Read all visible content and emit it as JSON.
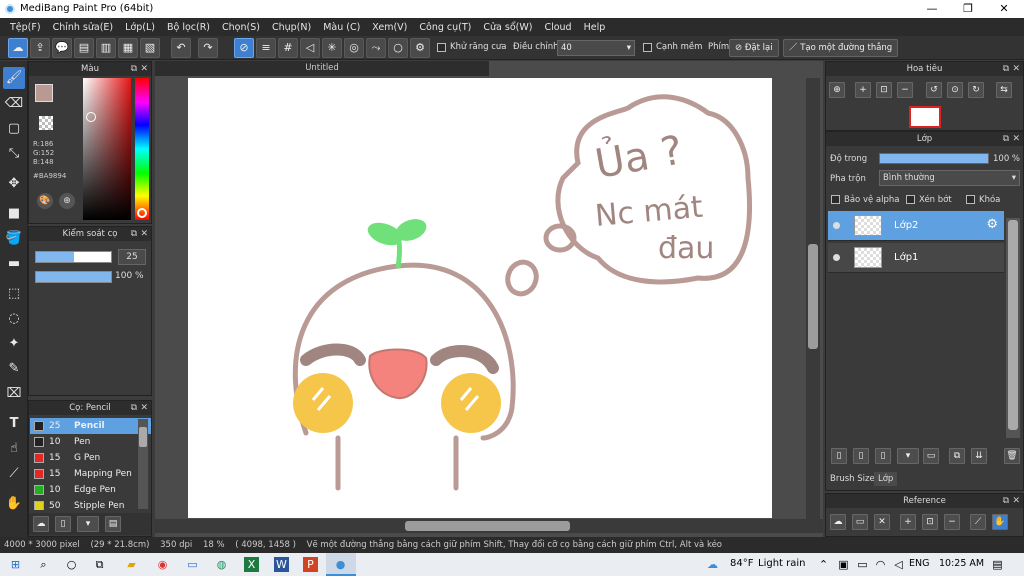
{
  "window": {
    "title": "MediBang Paint Pro (64bit)",
    "min": "—",
    "max": "❐",
    "close": "✕"
  },
  "menu": [
    "Tệp(F)",
    "Chỉnh sửa(E)",
    "Lớp(L)",
    "Bộ lọc(R)",
    "Chọn(S)",
    "Chụp(N)",
    "Màu (C)",
    "Xem(V)",
    "Công cụ(T)",
    "Cửa sổ(W)",
    "Cloud",
    "Help"
  ],
  "toolbar": {
    "antialias_label": "Khử răng cưa",
    "adjust_label": "Điều chỉnh",
    "adjust_value": "40",
    "soft_edge_label": "Cạnh mềm",
    "key_label": "Phím",
    "reset_label": "Đặt lại",
    "straight_line_label": "Tạo một đường thẳng"
  },
  "color_panel": {
    "title": "Màu",
    "r": "R:186",
    "g": "G:152",
    "b": "B:148",
    "hex": "#BA9894",
    "primary_color": "#BA9894"
  },
  "brush_control": {
    "title": "Kiểm soát cọ",
    "size": "25",
    "opacity": "100 %"
  },
  "brush_panel": {
    "title": "Cọ: Pencil",
    "items": [
      {
        "size": "25",
        "name": "Pencil",
        "color": "#222222"
      },
      {
        "size": "10",
        "name": "Pen",
        "color": "#222222"
      },
      {
        "size": "15",
        "name": "G Pen",
        "color": "#e02828"
      },
      {
        "size": "15",
        "name": "Mapping Pen",
        "color": "#e02828"
      },
      {
        "size": "10",
        "name": "Edge Pen",
        "color": "#20b020"
      },
      {
        "size": "50",
        "name": "Stipple Pen",
        "color": "#e0d020"
      }
    ]
  },
  "canvas": {
    "doc_title": "Untitled",
    "drawing_text": [
      "Ủa ?",
      "Nc mát",
      "đau"
    ]
  },
  "navigator": {
    "title": "Hoa tiêu"
  },
  "layer_panel": {
    "title": "Lớp",
    "opacity_label": "Độ trong",
    "opacity_value": "100 %",
    "blend_label": "Pha trộn",
    "blend_value": "Bình thường",
    "protect_alpha": "Bảo vệ alpha",
    "clipping": "Xén bớt",
    "lock": "Khóa",
    "layers": [
      {
        "name": "Lớp2",
        "selected": true
      },
      {
        "name": "Lớp1",
        "selected": false
      }
    ],
    "tab_brush_size": "Brush Size",
    "tab_layer": "Lớp"
  },
  "reference_panel": {
    "title": "Reference"
  },
  "status": {
    "size": "4000 * 3000 pixel",
    "cm": "(29 * 21.8cm)",
    "dpi": "350 dpi",
    "zoom": "18 %",
    "coords": "( 4098, 1458 )",
    "hint": "Vẽ một đường thẳng bằng cách giữ phím Shift, Thay đổi cỡ cọ bằng cách giữ phím Ctrl, Alt và kéo"
  },
  "taskbar": {
    "weather_temp": "84°F",
    "weather_text": "Light rain",
    "lang": "ENG",
    "time": "10:25 AM"
  }
}
